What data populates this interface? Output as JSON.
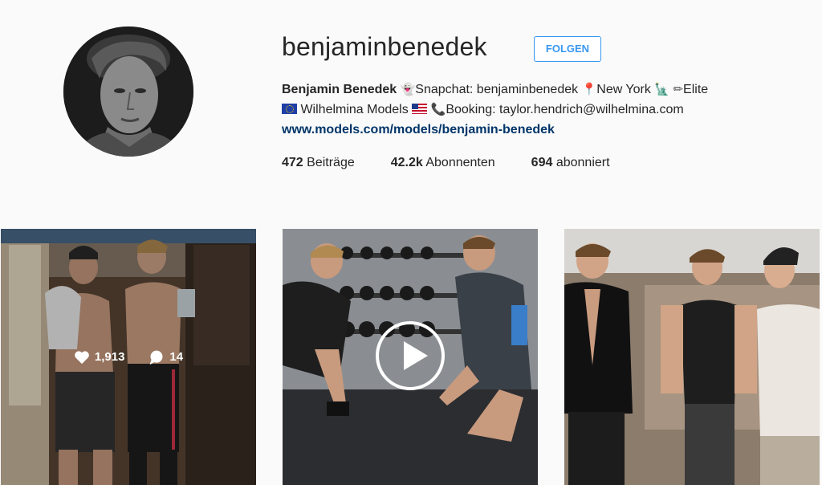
{
  "profile": {
    "username": "benjaminbenedek",
    "follow_label": "FOLGEN",
    "full_name": "Benjamin Benedek",
    "bio_line1_part1": "Snapchat: benjaminbenedek",
    "bio_line1_part2": "New York",
    "bio_line1_part3": "Elite",
    "bio_line2_part1": "Wilhelmina Models",
    "bio_line2_part2": "Booking: taylor.hendrich@wilhelmina.com",
    "website": "www.models.com/models/benjamin-benedek"
  },
  "stats": [
    {
      "value": "472",
      "label": "Beiträge"
    },
    {
      "value": "42.2k",
      "label": "Abonnenten"
    },
    {
      "value": "694",
      "label": "abonniert"
    }
  ],
  "posts": [
    {
      "kind": "photo",
      "likes": "1,913",
      "comments": "14"
    },
    {
      "kind": "video"
    },
    {
      "kind": "photo"
    }
  ],
  "icons": {
    "ghost": "snapchat-ghost-icon",
    "pin": "location-pin-icon",
    "liberty": "statue-of-liberty-icon",
    "pencil": "pencil-icon",
    "eu_flag": "eu-flag-icon",
    "us_flag": "us-flag-icon",
    "phone": "phone-icon"
  }
}
